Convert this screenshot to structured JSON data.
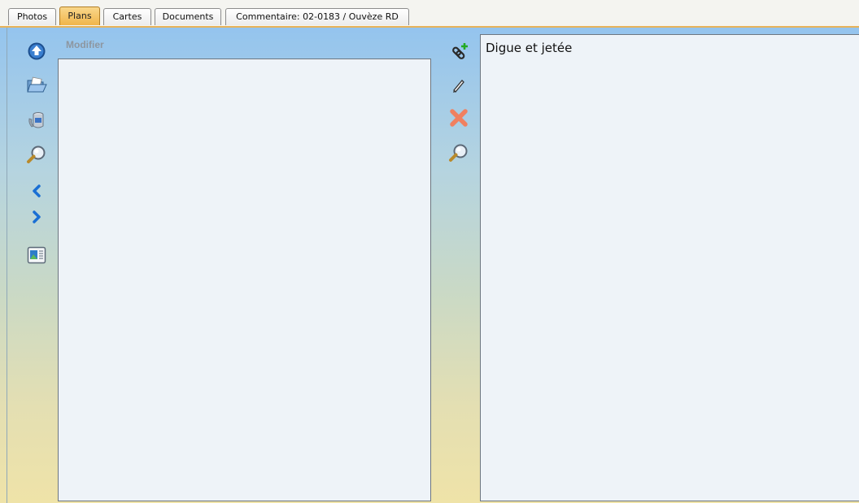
{
  "tabs": [
    {
      "label": "Photos",
      "active": false
    },
    {
      "label": "Plans",
      "active": true
    },
    {
      "label": "Cartes",
      "active": false
    },
    {
      "label": "Documents",
      "active": false
    },
    {
      "label": "Commentaire: 02-0183 / Ouvèze RD",
      "active": false
    }
  ],
  "left_toolbar": {
    "icons": [
      "upload-icon",
      "open-folder-icon",
      "paint-bucket-icon",
      "magnify-icon",
      "previous-icon",
      "next-icon",
      "image-preview-icon"
    ]
  },
  "editor": {
    "label": "Modifier"
  },
  "middle_toolbar": {
    "icons": [
      "add-link-icon",
      "pencil-icon",
      "delete-icon",
      "magnify-icon"
    ]
  },
  "comment": {
    "text": "Digue et jetée"
  },
  "colors": {
    "active_tab": "#f0b54a",
    "panel_top": "#94c4ee",
    "panel_bottom": "#efe3a8",
    "delete": "#f08060",
    "nav_arrow": "#1a6fd4"
  }
}
